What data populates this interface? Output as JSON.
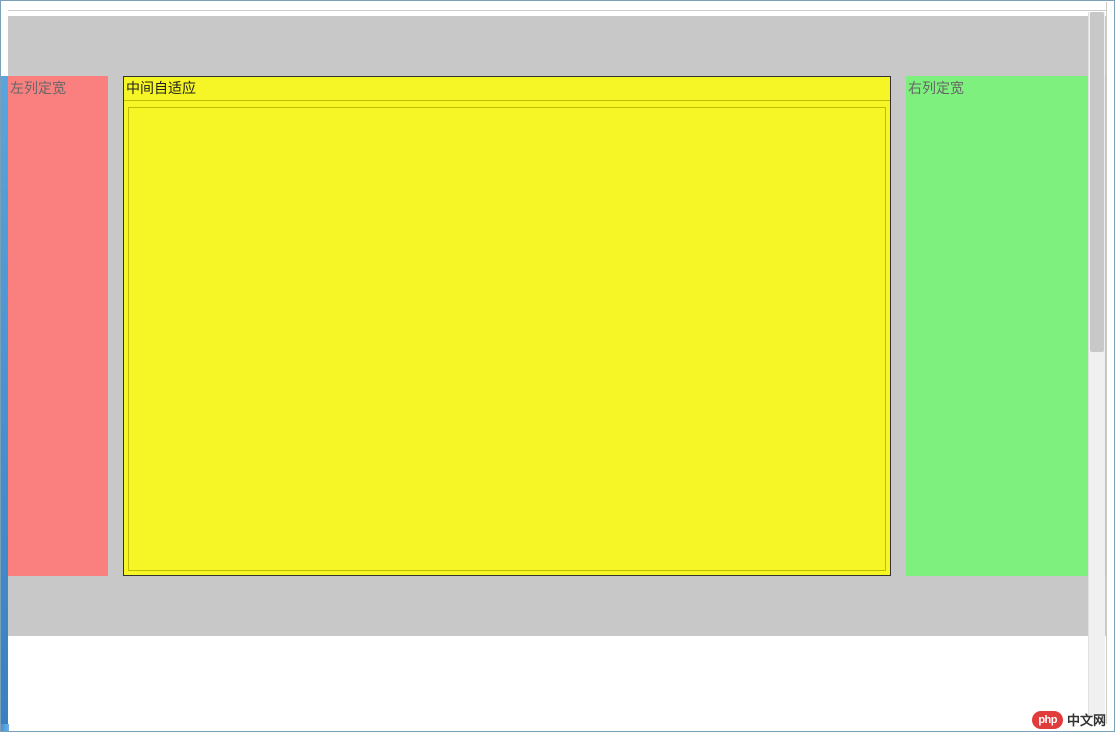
{
  "layout": {
    "left_label": "左列定宽",
    "center_label": "中间自适应",
    "right_label": "右列定宽"
  },
  "watermark": {
    "logo_text": "php",
    "site_text": "中文网"
  },
  "colors": {
    "left_bg": "#fa8080",
    "center_bg": "#f6f525",
    "right_bg": "#7ef07e",
    "container_bg": "#c8c8c8"
  }
}
